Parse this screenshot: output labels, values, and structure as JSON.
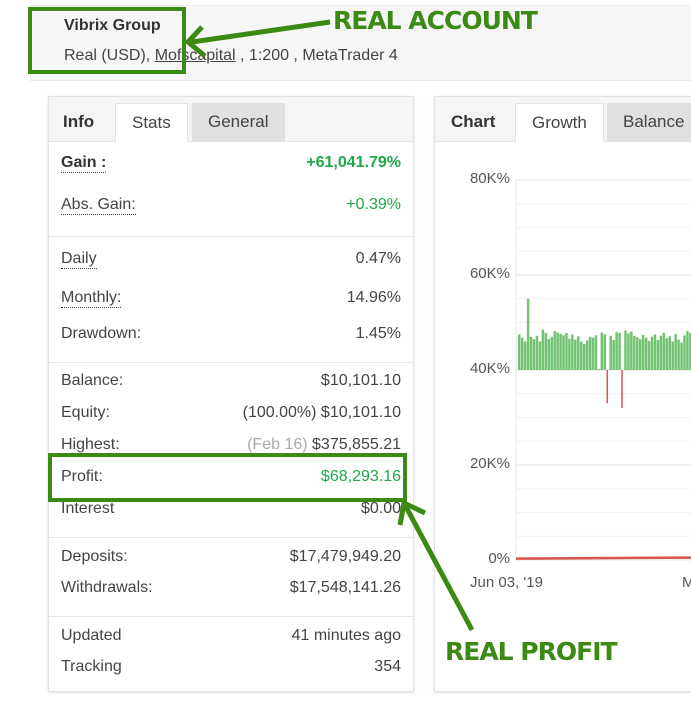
{
  "header": {
    "title": "Vibrix Group",
    "account_type": "Real (USD),",
    "broker": "Mofscapital",
    "rest": " , 1:200 , MetaTrader 4"
  },
  "left_tabs": {
    "label": "Info",
    "items": [
      "Stats",
      "General"
    ],
    "active": "Stats"
  },
  "stats": [
    {
      "k": "Gain :",
      "v": "+61,041.79%"
    },
    {
      "k": "Abs. Gain:",
      "v": "+0.39%"
    },
    {
      "k": "Daily",
      "v": "0.47%"
    },
    {
      "k": "Monthly:",
      "v": "14.96%"
    },
    {
      "k": "Drawdown:",
      "v": "1.45%"
    },
    {
      "k": "Balance:",
      "v": "$10,101.10"
    },
    {
      "k": "Equity:",
      "pre": "(100.00%)",
      "v": "$10,101.10"
    },
    {
      "k": "Highest:",
      "pre": "(Feb 16)",
      "v": "$375,855.21"
    },
    {
      "k": "Profit:",
      "v": "$68,293.16"
    },
    {
      "k": "Interest",
      "v": "$0.00"
    },
    {
      "k": "Deposits:",
      "v": "$17,479,949.20"
    },
    {
      "k": "Withdrawals:",
      "v": "$17,548,141.26"
    },
    {
      "k": "Updated",
      "v": "41 minutes ago"
    },
    {
      "k": "Tracking",
      "v": "354"
    }
  ],
  "right_tabs": {
    "label": "Chart",
    "items": [
      "Growth",
      "Balance"
    ],
    "active": "Growth"
  },
  "annotations": {
    "account": "REAL ACCOUNT",
    "profit": "REAL PROFIT",
    "color": "#3a8a14"
  },
  "chart_data": {
    "type": "bar",
    "y_ticks": [
      "80K%",
      "60K%",
      "40K%",
      "20K%",
      "0%"
    ],
    "ylim": [
      0,
      80000
    ],
    "x_ticks": [
      "Jun 03, '19",
      "M"
    ],
    "base": 40000,
    "values": [
      47500,
      46800,
      46000,
      55000,
      47000,
      46500,
      47200,
      46000,
      48500,
      47800,
      46500,
      47000,
      48200,
      47900,
      47600,
      47300,
      47800,
      46600,
      47500,
      46400,
      47100,
      46000,
      45500,
      46200,
      47000,
      46800,
      47300,
      40200,
      47900,
      47500,
      33000,
      47200,
      46300,
      48000,
      47800,
      32000,
      48300,
      47700,
      48100,
      47200,
      46900,
      46500,
      47400,
      46800,
      46100,
      47000,
      47500,
      46300,
      47200,
      47800,
      46700,
      47100,
      46000,
      47600,
      46400,
      45800,
      47300,
      48200,
      47800,
      46900,
      47500
    ],
    "line_values": [
      300
    ],
    "colors": {
      "up": "#5cb85c",
      "down": "#d9534f",
      "line": "#d9534f"
    }
  }
}
